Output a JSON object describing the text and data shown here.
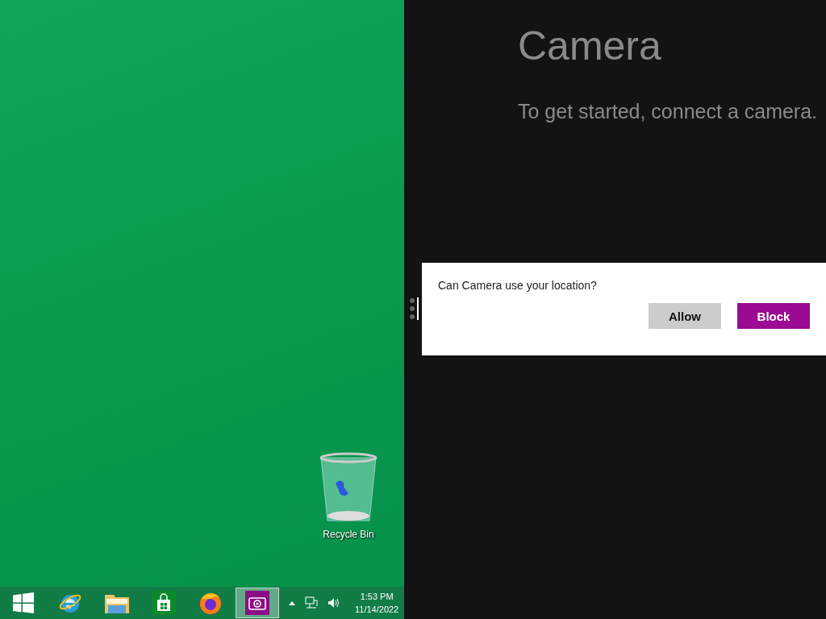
{
  "desktop": {
    "icons": [
      {
        "label": "Recycle Bin"
      }
    ]
  },
  "taskbar": {
    "apps": [
      {
        "kind": "start",
        "selected": false
      },
      {
        "kind": "browser",
        "selected": false
      },
      {
        "kind": "folder",
        "selected": false
      },
      {
        "kind": "store",
        "selected": false
      },
      {
        "kind": "firefox",
        "selected": false
      },
      {
        "kind": "camera",
        "selected": true
      }
    ],
    "clock": {
      "time": "1:53 PM",
      "date": "11/14/2022"
    }
  },
  "app": {
    "title": "Camera",
    "message": "To get started, connect a camera."
  },
  "dialog": {
    "question": "Can Camera use your location?",
    "buttons": [
      {
        "label": "Allow",
        "kind": "secondary"
      },
      {
        "label": "Block",
        "kind": "primary"
      }
    ]
  }
}
